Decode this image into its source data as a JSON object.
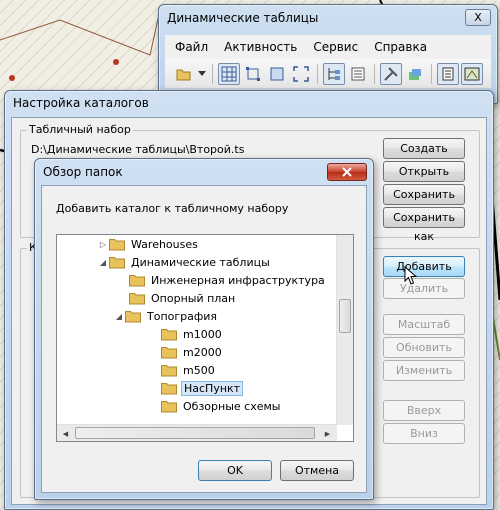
{
  "dynamic_window": {
    "title": "Динамические таблицы",
    "close_label": "X",
    "menu": [
      "Файл",
      "Активность",
      "Сервис",
      "Справка"
    ]
  },
  "catalog_window": {
    "title": "Настройка каталогов",
    "tabset_group_label": "Табличный набор",
    "tabset_path": "D:\\Динамические таблицы\\Второй.ts",
    "catalog_group_label": "К",
    "buttons": {
      "create": "Создать",
      "open": "Открыть",
      "save": "Сохранить",
      "save_as": "Сохранить как",
      "add": "Добавить",
      "delete": "Удалить",
      "scale": "Масштаб",
      "refresh": "Обновить",
      "change": "Изменить",
      "up": "Вверх",
      "down": "Вниз"
    }
  },
  "browse_dialog": {
    "title": "Обзор папок",
    "prompt": "Добавить каталог к табличному набору",
    "tree": [
      {
        "label": "Warehouses",
        "expanded": false,
        "selected": false
      },
      {
        "label": "Динамические таблицы",
        "expanded": true,
        "selected": false
      },
      {
        "label": "Инженерная инфраструктура",
        "expanded": null,
        "selected": false
      },
      {
        "label": "Опорный план",
        "expanded": null,
        "selected": false
      },
      {
        "label": "Топография",
        "expanded": true,
        "selected": false
      },
      {
        "label": "m1000",
        "expanded": null,
        "selected": false
      },
      {
        "label": "m2000",
        "expanded": null,
        "selected": false
      },
      {
        "label": "m500",
        "expanded": null,
        "selected": false
      },
      {
        "label": "НасПункт",
        "expanded": null,
        "selected": true
      },
      {
        "label": "Обзорные схемы",
        "expanded": null,
        "selected": false
      }
    ],
    "ok_label": "OK",
    "cancel_label": "Отмена"
  },
  "colors": {
    "folder": "#e8c25a",
    "selection": "#d5e7f7",
    "title_bar": "#c4d8ee"
  }
}
